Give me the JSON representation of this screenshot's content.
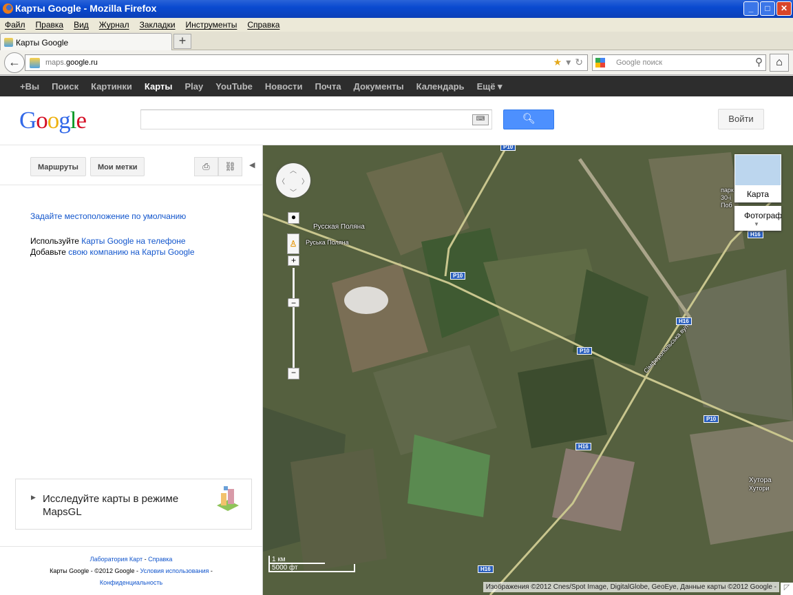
{
  "window": {
    "title": "Карты Google - Mozilla Firefox",
    "buttons": {
      "minimize": "_",
      "maximize": "□",
      "close": "✕"
    }
  },
  "menu": [
    "Файл",
    "Правка",
    "Вид",
    "Журнал",
    "Закладки",
    "Инструменты",
    "Справка"
  ],
  "tab": {
    "label": "Карты Google",
    "new_tab": "+"
  },
  "nav": {
    "url_prefix": "maps.",
    "url_domain": "google.ru",
    "search_placeholder": "Google поиск"
  },
  "gbar": [
    "+Вы",
    "Поиск",
    "Картинки",
    "Карты",
    "Play",
    "YouTube",
    "Новости",
    "Почта",
    "Документы",
    "Календарь",
    "Ещё ▾"
  ],
  "header": {
    "logo": "Google",
    "login": "Войти"
  },
  "panel": {
    "routes": "Маршруты",
    "my_places": "Мои метки",
    "set_location": "Задайте местоположение по умолчанию",
    "use_prefix": "Используйте ",
    "use_link": "Карты Google на телефоне",
    "add_prefix": "Добавьте ",
    "add_link": "свою компанию на Карты Google",
    "mapsgl": "Исследуйте карты в режиме MapsGL",
    "footer": {
      "labs": "Лаборатория Карт",
      "help": "Справка",
      "copyright": "Карты Google - ©2012 Google - ",
      "terms": "Условия использования",
      "privacy": "Конфиденциальность"
    }
  },
  "map": {
    "type_map": "Карта",
    "type_sat": "Фотограф",
    "labels": {
      "town1": "Русская Поляна",
      "town1b": "Руська Поляна",
      "town2": "Хутора",
      "town2b": "Хутори",
      "street": "Сімферопольська вул",
      "park": "парк 30-і Поб"
    },
    "roads": {
      "p10": "P10",
      "h16": "H16"
    },
    "scale": {
      "km": "1 км",
      "ft": "5000 фт"
    },
    "attribution": "Изображения ©2012 Cnes/Spot Image, DigitalGlobe, GeoEye, Данные карты ©2012 Google -"
  }
}
